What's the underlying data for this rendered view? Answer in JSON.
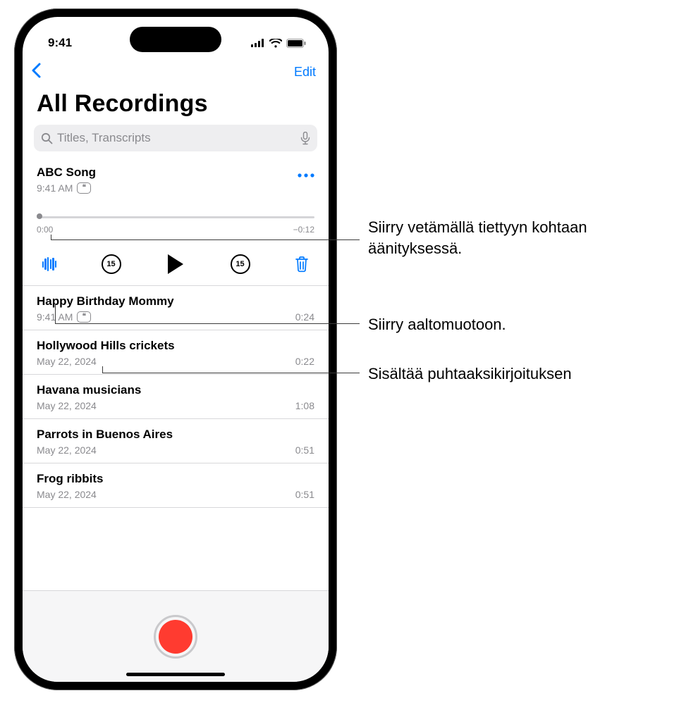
{
  "status_bar": {
    "time": "9:41"
  },
  "nav": {
    "edit": "Edit"
  },
  "title": "All Recordings",
  "search": {
    "placeholder": "Titles, Transcripts"
  },
  "expanded_recording": {
    "title": "ABC Song",
    "subtitle_time": "9:41 AM",
    "elapsed": "0:00",
    "remaining": "−0:12",
    "skip_back_label": "15",
    "skip_fwd_label": "15"
  },
  "recordings": [
    {
      "title": "Happy Birthday Mommy",
      "subtitle": "9:41 AM",
      "duration": "0:24",
      "has_transcript": true
    },
    {
      "title": "Hollywood Hills crickets",
      "subtitle": "May 22, 2024",
      "duration": "0:22",
      "has_transcript": false
    },
    {
      "title": "Havana musicians",
      "subtitle": "May 22, 2024",
      "duration": "1:08",
      "has_transcript": false
    },
    {
      "title": "Parrots in Buenos Aires",
      "subtitle": "May 22, 2024",
      "duration": "0:51",
      "has_transcript": false
    },
    {
      "title": "Frog ribbits",
      "subtitle": "May 22, 2024",
      "duration": "0:51",
      "has_transcript": false
    }
  ],
  "callouts": {
    "scrubber": "Siirry vetämällä tiettyyn kohtaan äänityksessä.",
    "waveform": "Siirry aaltomuotoon.",
    "transcript": "Sisältää puhtaaksikirjoituksen"
  }
}
